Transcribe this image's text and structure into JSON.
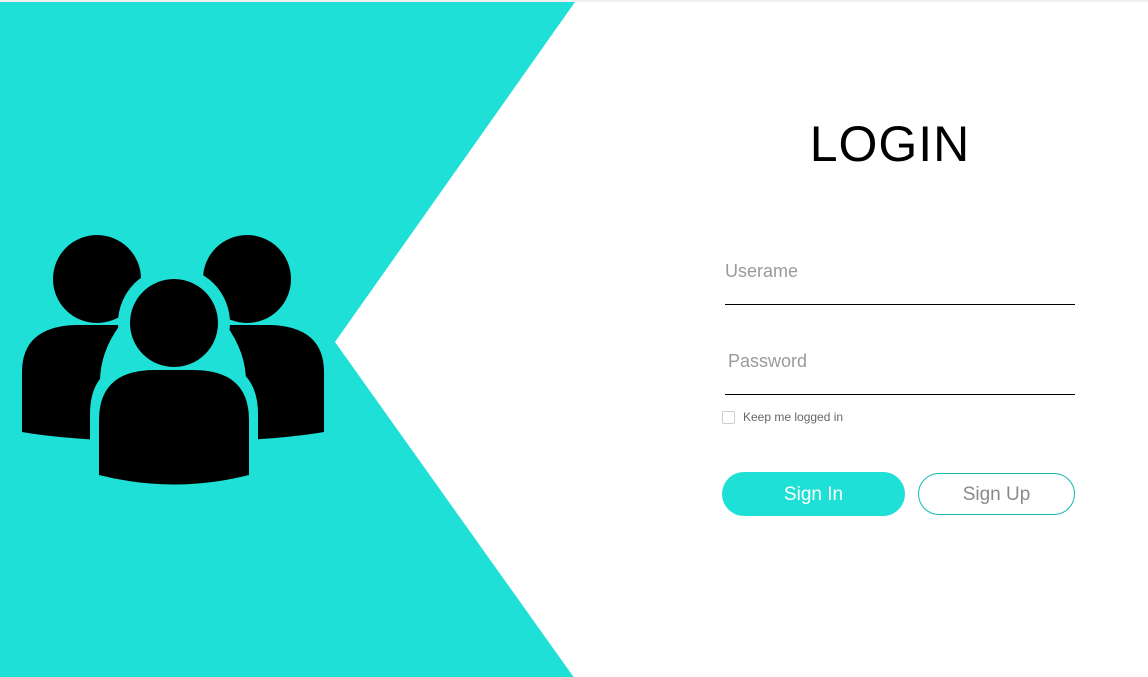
{
  "colors": {
    "accent": "#1fe0d6",
    "accent_border": "#14b8b0",
    "icon": "#000000",
    "background": "#ffffff"
  },
  "hero": {
    "icon_name": "users-group-icon"
  },
  "login": {
    "title": "LOGIN",
    "username": {
      "placeholder": "Userame",
      "value": ""
    },
    "password": {
      "placeholder": "Password",
      "value": ""
    },
    "remember": {
      "label": "Keep me logged in",
      "checked": false
    },
    "signin_label": "Sign In",
    "signup_label": "Sign Up"
  }
}
